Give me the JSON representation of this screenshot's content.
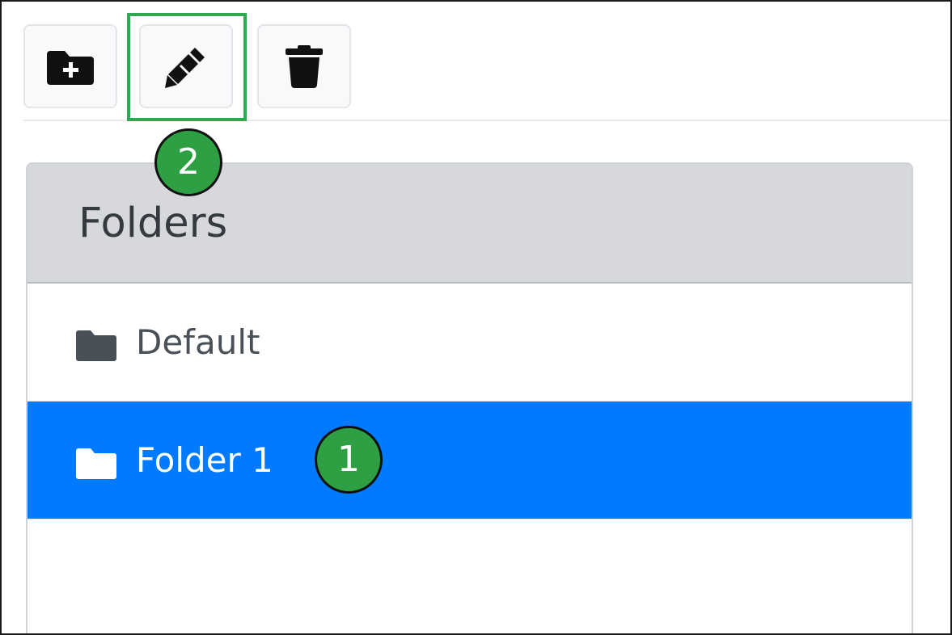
{
  "toolbar": {
    "buttons": [
      {
        "name": "new-folder",
        "icon": "folder-plus-icon"
      },
      {
        "name": "rename-folder",
        "icon": "pencil-icon"
      },
      {
        "name": "delete-folder",
        "icon": "trash-icon"
      }
    ]
  },
  "panel": {
    "title": "Folders",
    "items": [
      {
        "label": "Default",
        "icon": "folder-icon",
        "selected": false
      },
      {
        "label": "Folder 1",
        "icon": "folder-icon",
        "selected": true
      }
    ]
  },
  "callouts": [
    {
      "number": "1",
      "target": "Folder 1"
    },
    {
      "number": "2",
      "target": "rename-folder"
    }
  ],
  "colors": {
    "selected_bg": "#007bff",
    "callout_green": "#2ea043",
    "highlight_green": "#2fa84f",
    "header_bg": "#d6d8db"
  }
}
